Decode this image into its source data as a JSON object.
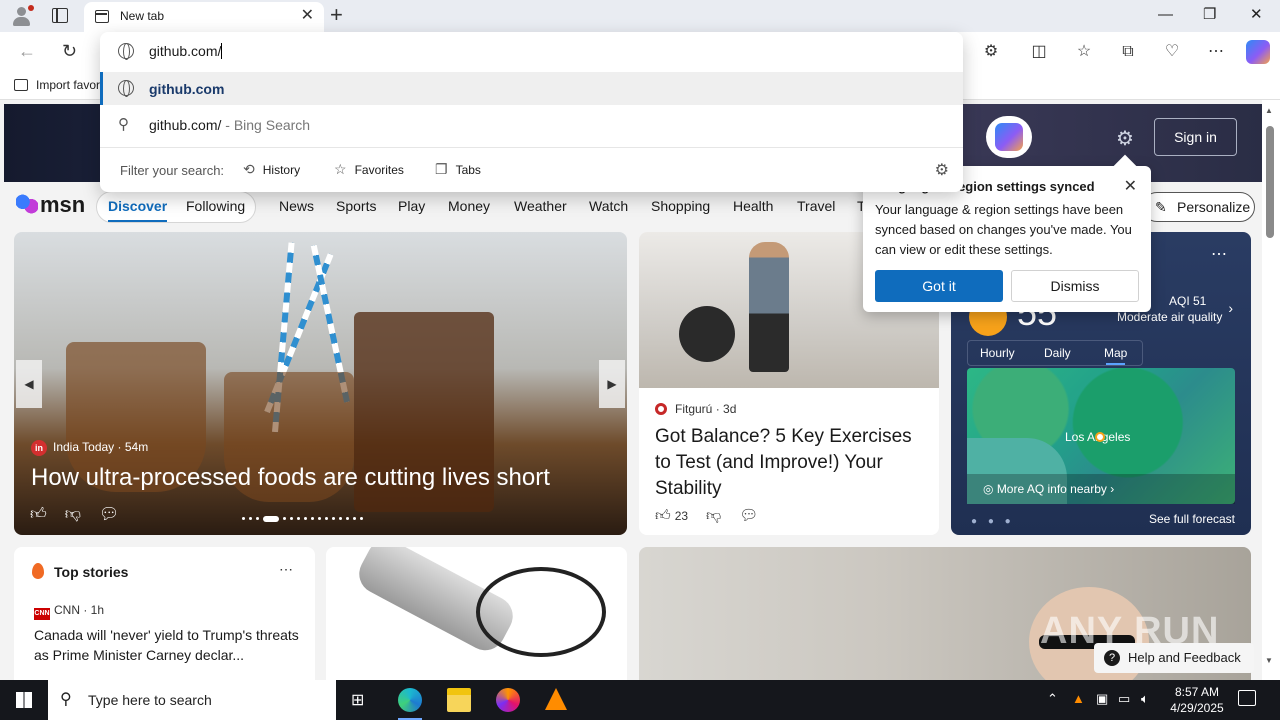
{
  "browser": {
    "tab_title": "New tab",
    "favorites_bar_item": "Import favorites"
  },
  "omnibox": {
    "input_value": "github.com/",
    "suggestion_url": "github.com",
    "suggestion_search_query": "github.com/",
    "suggestion_search_suffix": " - Bing Search",
    "filter_label": "Filter your search:",
    "filters": [
      "History",
      "Favorites",
      "Tabs"
    ]
  },
  "msn": {
    "logo": "msn",
    "sign_in": "Sign in",
    "categories": [
      "Discover",
      "Following",
      "News",
      "Sports",
      "Play",
      "Money",
      "Weather",
      "Watch",
      "Shopping",
      "Health",
      "Travel",
      "T"
    ],
    "personalize": "Personalize"
  },
  "sync_popup": {
    "title": "Language & region settings synced",
    "message": "Your language & region settings have been synced based on changes you've made. You can view or edit these settings.",
    "primary_button": "Got it",
    "secondary_button": "Dismiss"
  },
  "hero": {
    "source": "India Today",
    "age": "54m",
    "title": "How ultra-processed foods are cutting lives short"
  },
  "card_fitness": {
    "source": "Fitgurú",
    "age": "3d",
    "title": "Got Balance? 5 Key Exercises to Test (and Improve!) Your Stability",
    "likes": "23"
  },
  "weather": {
    "temperature": "55",
    "aqi": "AQI 51",
    "aqi_desc": "Moderate air quality",
    "tabs": [
      "Hourly",
      "Daily",
      "Map"
    ],
    "active_tab": "Map",
    "map_city": "Los Angeles",
    "aq_link": "More AQ info nearby",
    "forecast_link": "See full forecast"
  },
  "top_stories": {
    "header": "Top stories",
    "source": "CNN",
    "age": "1h",
    "headline": "Canada will 'never' yield to Trump's threats as Prime Minister Carney declar..."
  },
  "watermark": "ANY RUN",
  "help": "Help and Feedback",
  "taskbar": {
    "search_placeholder": "Type here to search",
    "time": "8:57 AM",
    "date": "4/29/2025"
  }
}
